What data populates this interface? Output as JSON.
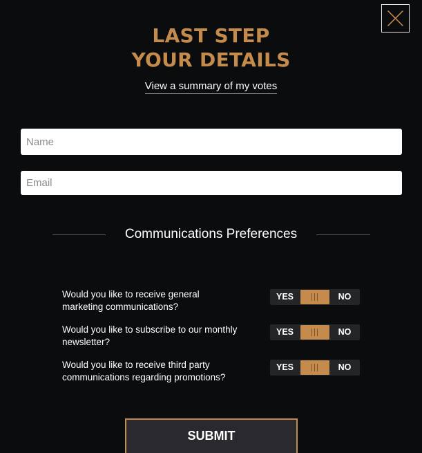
{
  "header": {
    "title_line1": "LAST STEP",
    "title_line2": "YOUR DETAILS",
    "summary_link": "View a summary of my votes"
  },
  "form": {
    "name_placeholder": "Name",
    "email_placeholder": "Email"
  },
  "preferences": {
    "section_title": "Communications Preferences",
    "items": [
      {
        "line1": "Would you like to receive general",
        "line2": "marketing communications?",
        "yes_label": "YES",
        "no_label": "NO",
        "state": "neutral"
      },
      {
        "line1": "Would you like to subscribe to our monthly",
        "line2": "newsletter?",
        "yes_label": "YES",
        "no_label": "NO",
        "state": "neutral"
      },
      {
        "line1": "Would you like to receive third party",
        "line2": "communications regarding promotions?",
        "yes_label": "YES",
        "no_label": "NO",
        "state": "neutral"
      }
    ]
  },
  "actions": {
    "submit_label": "SUBMIT"
  },
  "icons": {
    "close": "close-icon",
    "toggle_knob": "grip-icon"
  },
  "colors": {
    "accent": "#c48b4d",
    "background": "#0b0c0e",
    "toggle_track": "#242528",
    "submit_bg": "#2a2a2e"
  }
}
